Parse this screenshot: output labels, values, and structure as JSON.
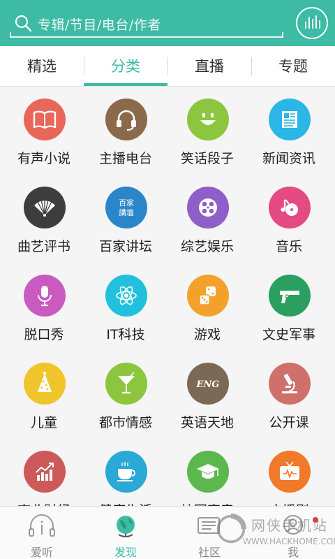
{
  "search": {
    "placeholder": "专辑/节目/电台/作者"
  },
  "tabs": [
    {
      "label": "精选"
    },
    {
      "label": "分类"
    },
    {
      "label": "直播"
    },
    {
      "label": "专题"
    }
  ],
  "categories": [
    {
      "label": "有声小说",
      "icon": "book-icon",
      "color": "#e8675a"
    },
    {
      "label": "主播电台",
      "icon": "headset-icon",
      "color": "#8a6a4a"
    },
    {
      "label": "笑话段子",
      "icon": "smiley-icon",
      "color": "#8cc63f"
    },
    {
      "label": "新闻资讯",
      "icon": "newspaper-icon",
      "color": "#2bb6e8"
    },
    {
      "label": "曲艺评书",
      "icon": "fan-icon",
      "color": "#3d3d3d"
    },
    {
      "label": "百家讲坛",
      "icon": "lecture-icon",
      "color": "#2a86c9",
      "icon_text": [
        "百家",
        "講壇"
      ]
    },
    {
      "label": "综艺娱乐",
      "icon": "film-reel-icon",
      "color": "#8e5ec9"
    },
    {
      "label": "音乐",
      "icon": "music-icon",
      "color": "#e44b82"
    },
    {
      "label": "脱口秀",
      "icon": "microphone-icon",
      "color": "#c95ac0"
    },
    {
      "label": "IT科技",
      "icon": "atom-icon",
      "color": "#21c1de"
    },
    {
      "label": "游戏",
      "icon": "dice-icon",
      "color": "#f3a12b"
    },
    {
      "label": "文史军事",
      "icon": "pistol-icon",
      "color": "#2a9f5f"
    },
    {
      "label": "儿童",
      "icon": "party-hat-icon",
      "color": "#f0c52c"
    },
    {
      "label": "都市情感",
      "icon": "cocktail-icon",
      "color": "#8cc63f"
    },
    {
      "label": "英语天地",
      "icon": "english-icon",
      "color": "#7a6a55",
      "icon_text": [
        "ENG"
      ]
    },
    {
      "label": "公开课",
      "icon": "microscope-icon",
      "color": "#d0706b"
    },
    {
      "label": "商业财经",
      "icon": "chart-up-icon",
      "color": "#cc5a5a"
    },
    {
      "label": "健康生活",
      "icon": "tea-cup-icon",
      "color": "#2aa8d6"
    },
    {
      "label": "校园声音",
      "icon": "graduation-cap-icon",
      "color": "#5ab84c"
    },
    {
      "label": "广播剧",
      "icon": "tv-icon",
      "color": "#f0792a"
    }
  ],
  "bottom_nav": [
    {
      "label": "爱听",
      "icon": "listen-icon"
    },
    {
      "label": "发现",
      "icon": "globe-icon"
    },
    {
      "label": "社区",
      "icon": "community-icon"
    },
    {
      "label": "我",
      "icon": "profile-icon"
    }
  ],
  "watermark": {
    "text": "网侠手机站",
    "url": "WWW.HACKHOME.COM"
  },
  "colors": {
    "accent": "#3dbba4",
    "badge": "#e53935"
  }
}
